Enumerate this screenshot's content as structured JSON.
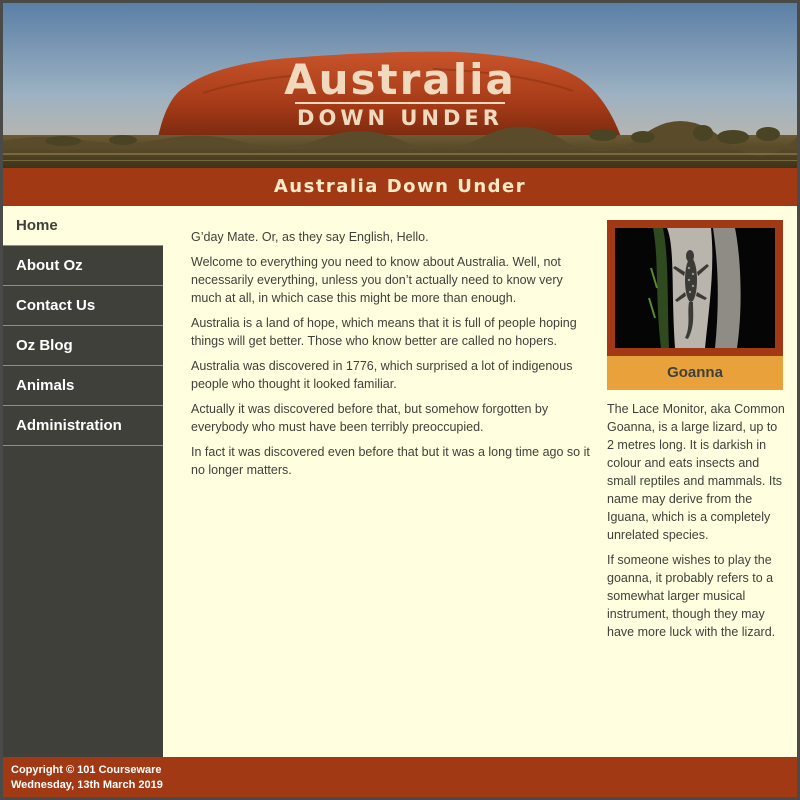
{
  "banner": {
    "title": "Australia",
    "subtitle": "DOWN UNDER"
  },
  "site": {
    "heading": "Australia Down Under"
  },
  "nav": {
    "items": [
      {
        "label": "Home",
        "active": true
      },
      {
        "label": "About Oz",
        "active": false
      },
      {
        "label": "Contact Us",
        "active": false
      },
      {
        "label": "Oz Blog",
        "active": false
      },
      {
        "label": "Animals",
        "active": false
      },
      {
        "label": "Administration",
        "active": false
      }
    ]
  },
  "main": {
    "paragraphs": [
      "G’day Mate. Or, as they say English, Hello.",
      "Welcome to everything you need to know about Australia. Well, not necessarily everything, unless you don’t actually need to know very much at all, in which case this might be more than enough.",
      "Australia is a land of hope, which means that it is full of people hoping things will get better. Those who know better are called no hopers.",
      "Australia was discovered in 1776, which surprised a lot of indigenous people who thought it looked familiar.",
      "Actually it was discovered before that, but somehow forgotten by everybody who must have been terribly preoccupied.",
      "In fact it was discovered even before that but it was a long time ago so it no longer matters."
    ]
  },
  "feature": {
    "caption": "Goanna",
    "image_icon": "lizard-photo",
    "paragraphs": [
      "The Lace Monitor, aka Common Goanna, is a large lizard, up to 2 metres long. It is darkish in colour and eats insects and small reptiles and mammals. Its name may derive from the Iguana, which is a completely unrelated species.",
      "If someone wishes to play the goanna, it probably refers to a somewhat larger musical instrument, though they may have more luck with the lizard."
    ]
  },
  "footer": {
    "copyright": "Copyright © 101 Courseware",
    "date": "Wednesday, 13th March 2019"
  },
  "colors": {
    "accent": "#a13a14",
    "sidebar": "#3f403a",
    "content_bg": "#ffffdf",
    "caption_bg": "#e9a23b"
  }
}
